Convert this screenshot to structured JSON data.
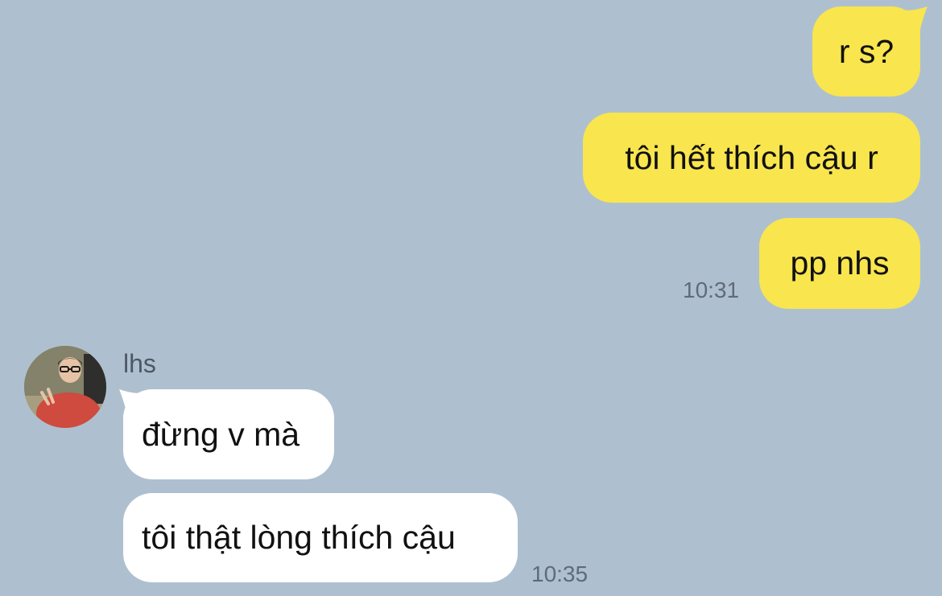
{
  "messages_sent": [
    {
      "text": "r s?"
    },
    {
      "text": "tôi hết thích cậu r"
    },
    {
      "text": "pp nhs",
      "time": "10:31"
    }
  ],
  "contact": {
    "name": "lhs",
    "avatar_icon": "profile-photo"
  },
  "messages_received": [
    {
      "text": "đừng v mà"
    },
    {
      "text": "tôi thật lòng thích cậu",
      "time": "10:35"
    }
  ],
  "colors": {
    "background": "#aec0d0",
    "outgoing_bubble": "#f9e54e",
    "incoming_bubble": "#ffffff",
    "timestamp": "#5f6b77"
  }
}
